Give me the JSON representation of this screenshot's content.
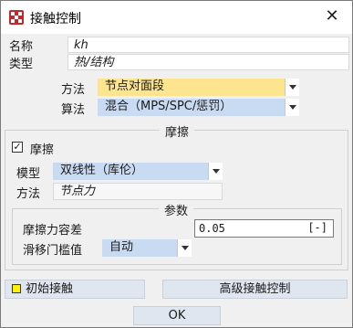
{
  "window": {
    "title": "接触控制",
    "close_glyph": "✕"
  },
  "fields": {
    "name_label": "名称",
    "name_value": "kh",
    "type_label": "类型",
    "type_value": "热/结构"
  },
  "method": {
    "label": "方法",
    "value": "节点对面段",
    "color": "#fde48e"
  },
  "algorithm": {
    "label": "算法",
    "value": "混合（MPS/SPC/惩罚）",
    "color": "#c9dbf3"
  },
  "friction_section": {
    "title": "摩擦",
    "checkbox_label": "摩擦",
    "checked": true,
    "model_label": "模型",
    "model_value": "双线性（库伦）",
    "method_label": "方法",
    "method_value": "节点力"
  },
  "params_section": {
    "title": "参数",
    "tolerance_label": "摩擦力容差",
    "tolerance_value": "0.05",
    "tolerance_unit": "[-]",
    "slip_label": "滑移门槛值",
    "slip_value": "自动"
  },
  "buttons": {
    "initial_contact": "初始接触",
    "advanced": "高级接触控制",
    "ok": "OK"
  },
  "colors": {
    "accent_yellow": "#fde48e",
    "accent_blue": "#c9dbf3",
    "button_blue": "#dfe6f0"
  }
}
